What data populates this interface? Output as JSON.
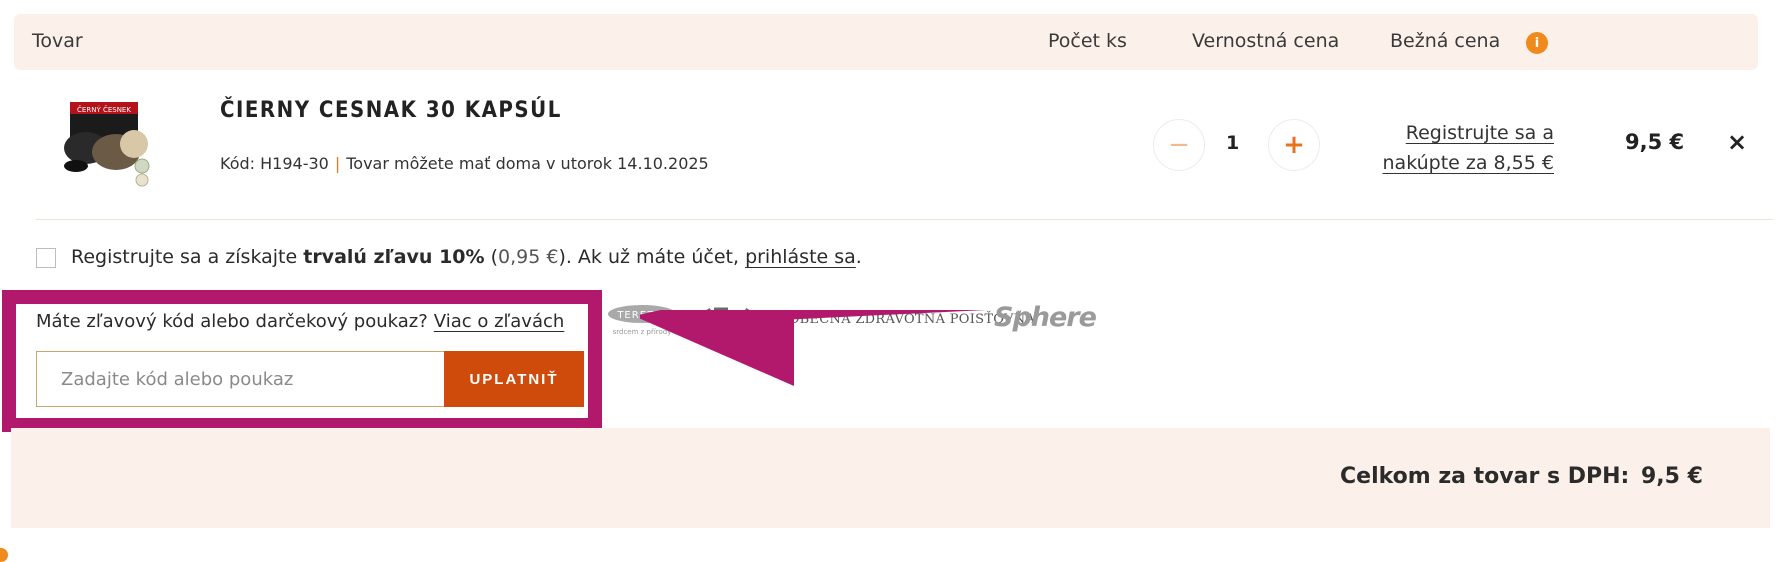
{
  "header": {
    "col_product": "Tovar",
    "col_qty": "Počet ks",
    "col_loyalty": "Vernostná cena",
    "col_loyalty_info": "i",
    "col_regular": "Bežná cena"
  },
  "cart_item": {
    "name": "ČIERNY CESNAK 30 KAPSÚL",
    "code": "Kód: H194-30",
    "separator": "|",
    "delivery": "Tovar môžete mať doma v utorok 14.10.2025",
    "quantity": "1",
    "qty_minus": "−",
    "qty_plus": "+",
    "loyalty_line1": "Registrujte sa a",
    "loyalty_line2": "nakúpte za 8,55 €",
    "price": "9,5 €",
    "remove": "×",
    "thumb_brand": "ČERNÝ ČESNEK"
  },
  "register": {
    "text_a": "Registrujte sa a získajte ",
    "bold": "trvalú zľavu 10%",
    "text_b": " (",
    "discount_amount": "0,95 €",
    "text_c": "). Ak už máte účet, ",
    "login_link": "prihláste sa",
    "text_d": "."
  },
  "coupon": {
    "question": "Máte zľavový kód alebo darčekový poukaz?",
    "more_link": "Viac o zľavách",
    "placeholder": "Zadajte kód alebo poukaz",
    "apply_label": "UPLATNIŤ"
  },
  "logos": {
    "terezia_name": "TEREZIA",
    "terezia_tagline": "srdcem z přírody",
    "vszp": "VŠEOBECNÁ ZDRAVOTNÁ POISŤOVŇA",
    "sphere": "Sphere"
  },
  "totals": {
    "label": "Celkom za tovar s DPH:",
    "value": "9,5 €"
  },
  "colors": {
    "accent_orange": "#cf4b0c",
    "highlight_magenta": "#b2186c",
    "band_bg": "#fcf1ea"
  }
}
